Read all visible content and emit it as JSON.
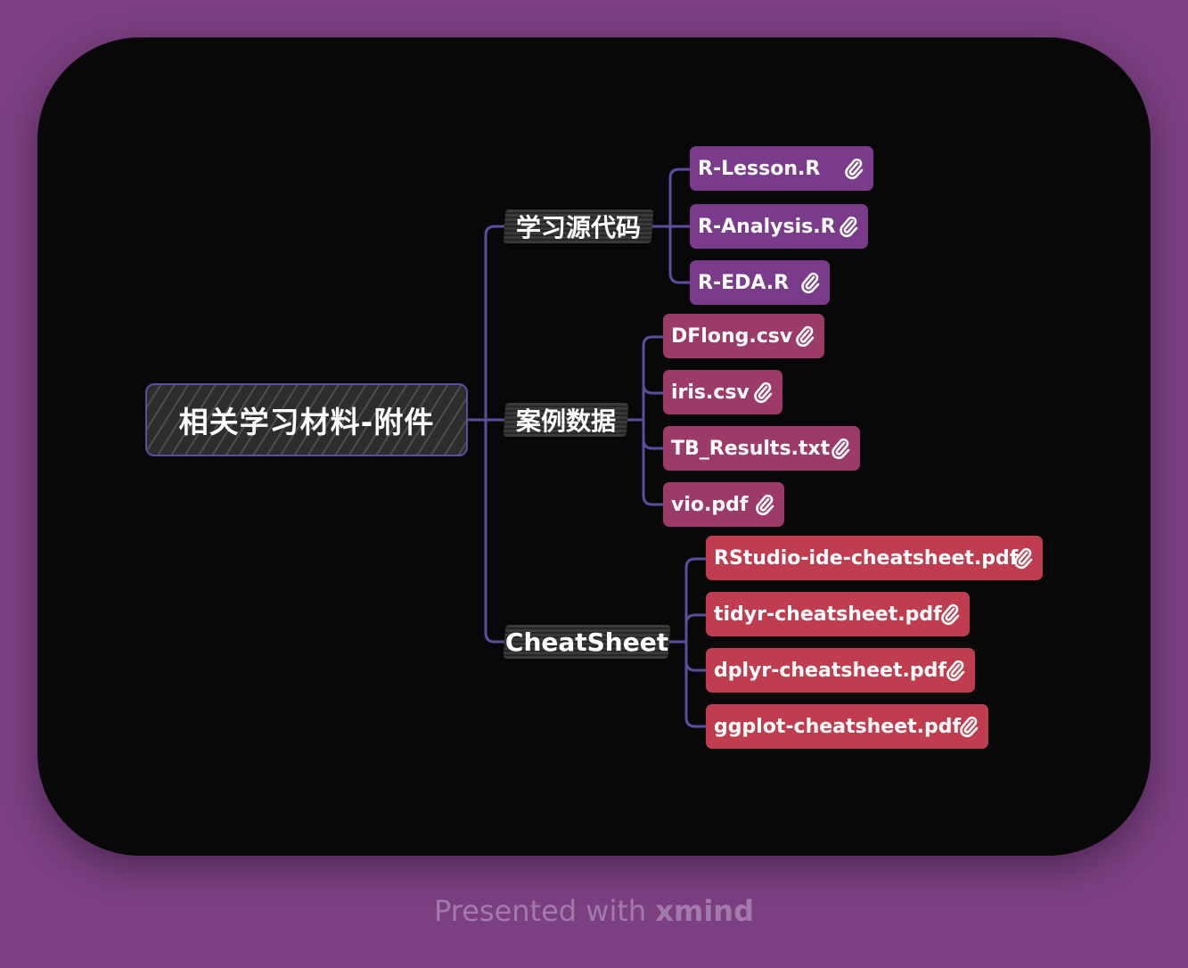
{
  "root": {
    "label": "相关学习材料-附件"
  },
  "branches": [
    {
      "label": "学习源代码",
      "items": [
        "R-Lesson.R",
        "R-Analysis.R",
        "R-EDA.R"
      ]
    },
    {
      "label": "案例数据",
      "items": [
        "DFlong.csv",
        "iris.csv",
        "TB_Results.txt",
        "vio.pdf"
      ]
    },
    {
      "label": "CheatSheet",
      "items": [
        "RStudio-ide-cheatsheet.pdf",
        "tidyr-cheatsheet.pdf",
        "dplyr-cheatsheet.pdf",
        "ggplot-cheatsheet.pdf"
      ]
    }
  ],
  "attachment_icon": "paperclip-icon",
  "colors": {
    "background": "#7b3f82",
    "canvas": "#080808",
    "connector": "#5a4f9e",
    "group_1": "#7a3c8a",
    "group_2": "#9c3a6a",
    "group_3": "#c03d4f"
  },
  "footer": {
    "prefix": "Presented with",
    "brand": "xmind"
  }
}
